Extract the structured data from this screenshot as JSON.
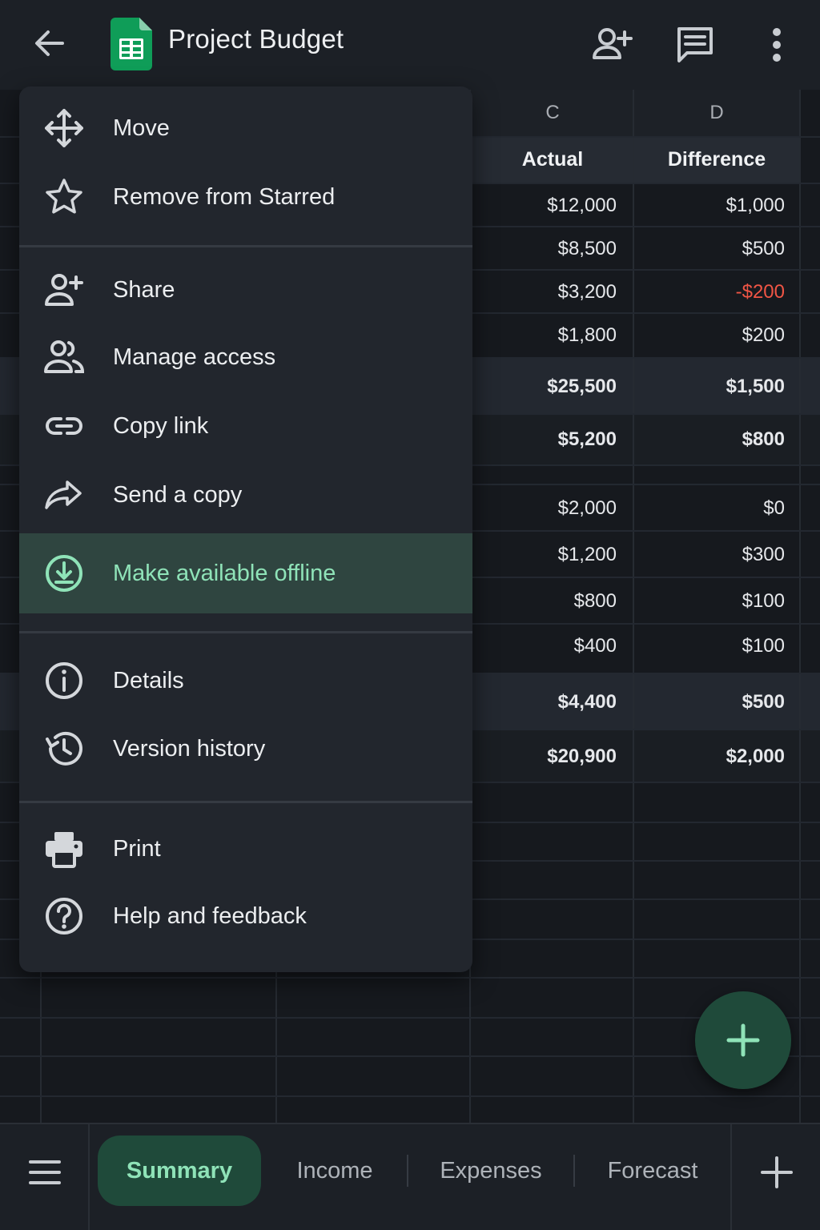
{
  "header": {
    "title": "Project Budget"
  },
  "columns": {
    "c_letter": "C",
    "d_letter": "D",
    "c_title": "Actual",
    "d_title": "Difference"
  },
  "rows": [
    {
      "actual": "$12,000",
      "diff": "$1,000"
    },
    {
      "actual": "$8,500",
      "diff": "$500"
    },
    {
      "actual": "$3,200",
      "diff": "-$200"
    },
    {
      "actual": "$1,800",
      "diff": "$200"
    },
    {
      "actual": "$25,500",
      "diff": "$1,500"
    },
    {
      "actual": "$5,200",
      "diff": "$800"
    },
    {
      "actual": "$2,000",
      "diff": "$0"
    },
    {
      "actual": "$1,200",
      "diff": "$300"
    },
    {
      "actual": "$800",
      "diff": "$100"
    },
    {
      "actual": "$400",
      "diff": "$100"
    },
    {
      "actual": "$4,400",
      "diff": "$500"
    },
    {
      "actual": "$20,900",
      "diff": "$2,000"
    }
  ],
  "menu": {
    "items": [
      {
        "label": "Move",
        "icon": "move-icon"
      },
      {
        "label": "Remove from Starred",
        "icon": "star-icon"
      },
      {
        "label": "Share",
        "icon": "person-add-icon"
      },
      {
        "label": "Manage access",
        "icon": "people-icon"
      },
      {
        "label": "Copy link",
        "icon": "link-icon"
      },
      {
        "label": "Send a copy",
        "icon": "share-arrow-icon"
      },
      {
        "label": "Make available offline",
        "icon": "download-circle-icon"
      },
      {
        "label": "Details",
        "icon": "info-icon"
      },
      {
        "label": "Version history",
        "icon": "history-icon"
      },
      {
        "label": "Print",
        "icon": "printer-icon"
      },
      {
        "label": "Help and feedback",
        "icon": "help-icon"
      }
    ]
  },
  "tabs": [
    {
      "label": "Summary"
    },
    {
      "label": "Income"
    },
    {
      "label": "Expenses"
    },
    {
      "label": "Forecast"
    }
  ],
  "colors": {
    "accent": "#8fe3b8",
    "accent_bg": "#1f4a3a",
    "negative": "#f05545",
    "sheets_green": "#0f9d58"
  }
}
